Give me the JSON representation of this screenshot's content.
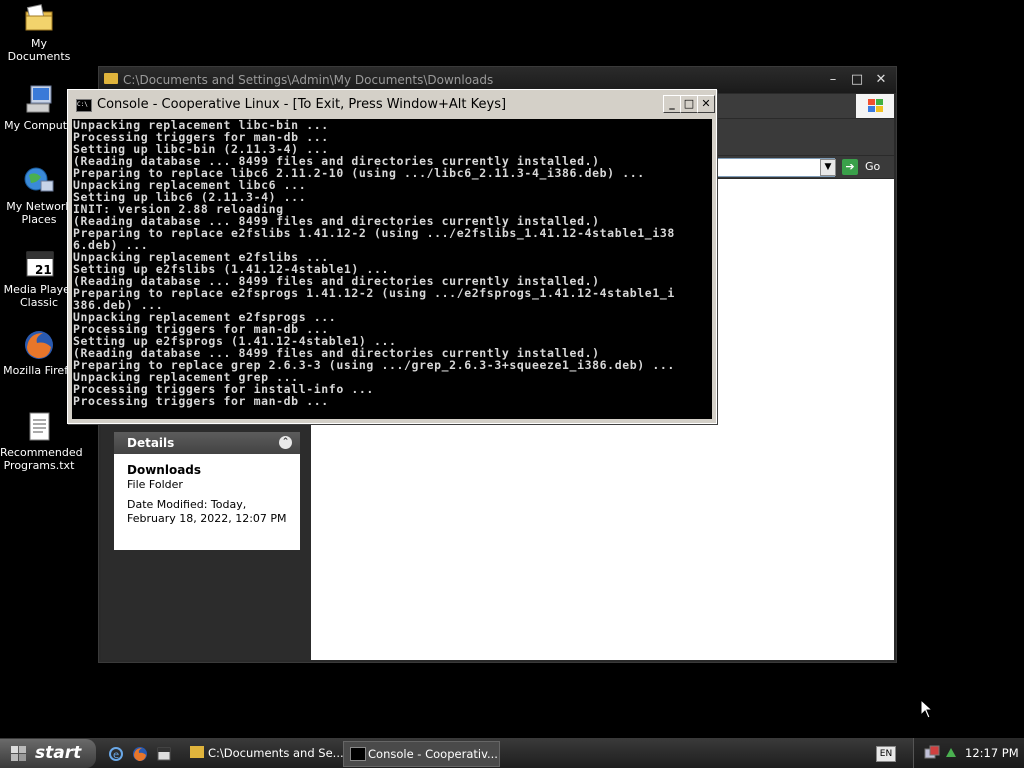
{
  "desktop": {
    "icons": [
      {
        "label": "My Documents",
        "icon": "my-documents-icon"
      },
      {
        "label": "My Compute",
        "icon": "my-computer-icon"
      },
      {
        "label": "My Network Places",
        "icon": "network-places-icon"
      },
      {
        "label": "Media Player Classic",
        "icon": "media-player-icon"
      },
      {
        "label": "Mozilla Firefo",
        "icon": "firefox-icon"
      },
      {
        "label": "Recommended Programs.txt",
        "icon": "text-file-icon"
      }
    ]
  },
  "explorer": {
    "title": "C:\\Documents and Settings\\Admin\\My Documents\\Downloads",
    "go_label": "Go",
    "details": {
      "header": "Details",
      "name": "Downloads",
      "type": "File Folder",
      "date_modified": "Date Modified: Today, February 18, 2022, 12:07 PM"
    }
  },
  "console": {
    "title": "Console - Cooperative Linux - [To Exit, Press Window+Alt Keys]",
    "lines": [
      "Unpacking replacement libc-bin ...",
      "Processing triggers for man-db ...",
      "Setting up libc-bin (2.11.3-4) ...",
      "(Reading database ... 8499 files and directories currently installed.)",
      "Preparing to replace libc6 2.11.2-10 (using .../libc6_2.11.3-4_i386.deb) ...",
      "Unpacking replacement libc6 ...",
      "Setting up libc6 (2.11.3-4) ...",
      "INIT: version 2.88 reloading",
      "(Reading database ... 8499 files and directories currently installed.)",
      "Preparing to replace e2fslibs 1.41.12-2 (using .../e2fslibs_1.41.12-4stable1_i38",
      "6.deb) ...",
      "Unpacking replacement e2fslibs ...",
      "Setting up e2fslibs (1.41.12-4stable1) ...",
      "(Reading database ... 8499 files and directories currently installed.)",
      "Preparing to replace e2fsprogs 1.41.12-2 (using .../e2fsprogs_1.41.12-4stable1_i",
      "386.deb) ...",
      "Unpacking replacement e2fsprogs ...",
      "Processing triggers for man-db ...",
      "Setting up e2fsprogs (1.41.12-4stable1) ...",
      "(Reading database ... 8499 files and directories currently installed.)",
      "Preparing to replace grep 2.6.3-3 (using .../grep_2.6.3-3+squeeze1_i386.deb) ...",
      "Unpacking replacement grep ...",
      "Processing triggers for install-info ...",
      "Processing triggers for man-db ..."
    ]
  },
  "taskbar": {
    "start_label": "start",
    "tasks": [
      {
        "label": "C:\\Documents and Se..."
      },
      {
        "label": "Console - Cooperativ..."
      }
    ],
    "language": "EN",
    "clock": "12:17 PM"
  }
}
